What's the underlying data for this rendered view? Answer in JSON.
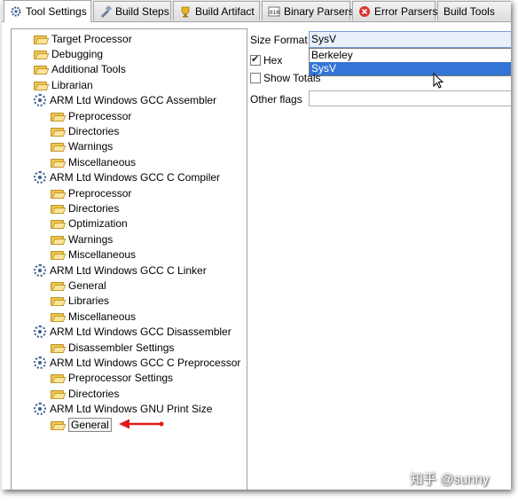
{
  "tabs": [
    {
      "label": "Tool Settings",
      "icon": "tool-settings-icon",
      "active": true
    },
    {
      "label": "Build Steps",
      "icon": "build-steps-icon"
    },
    {
      "label": "Build Artifact",
      "icon": "build-artifact-icon"
    },
    {
      "label": "Binary Parsers",
      "icon": "binary-parsers-icon"
    },
    {
      "label": "Error Parsers",
      "icon": "error-parsers-icon"
    },
    {
      "label": "Build Tools",
      "icon": ""
    }
  ],
  "tree": [
    {
      "label": "Target Processor",
      "level": 0,
      "icon": "folder-icon"
    },
    {
      "label": "Debugging",
      "level": 0,
      "icon": "folder-icon"
    },
    {
      "label": "Additional Tools",
      "level": 0,
      "icon": "folder-icon"
    },
    {
      "label": "Librarian",
      "level": 0,
      "icon": "folder-icon"
    },
    {
      "label": "ARM Ltd Windows GCC Assembler",
      "level": 0,
      "icon": "gear-icon"
    },
    {
      "label": "Preprocessor",
      "level": 1,
      "icon": "folder-icon"
    },
    {
      "label": "Directories",
      "level": 1,
      "icon": "folder-icon"
    },
    {
      "label": "Warnings",
      "level": 1,
      "icon": "folder-icon"
    },
    {
      "label": "Miscellaneous",
      "level": 1,
      "icon": "folder-icon"
    },
    {
      "label": "ARM Ltd Windows GCC C Compiler",
      "level": 0,
      "icon": "gear-icon"
    },
    {
      "label": "Preprocessor",
      "level": 1,
      "icon": "folder-icon"
    },
    {
      "label": "Directories",
      "level": 1,
      "icon": "folder-icon"
    },
    {
      "label": "Optimization",
      "level": 1,
      "icon": "folder-icon"
    },
    {
      "label": "Warnings",
      "level": 1,
      "icon": "folder-icon"
    },
    {
      "label": "Miscellaneous",
      "level": 1,
      "icon": "folder-icon"
    },
    {
      "label": "ARM Ltd Windows GCC C Linker",
      "level": 0,
      "icon": "gear-icon"
    },
    {
      "label": "General",
      "level": 1,
      "icon": "folder-icon"
    },
    {
      "label": "Libraries",
      "level": 1,
      "icon": "folder-icon"
    },
    {
      "label": "Miscellaneous",
      "level": 1,
      "icon": "folder-icon"
    },
    {
      "label": "ARM Ltd Windows GCC Disassembler",
      "level": 0,
      "icon": "gear-icon"
    },
    {
      "label": "Disassembler Settings",
      "level": 1,
      "icon": "folder-icon"
    },
    {
      "label": "ARM Ltd Windows GCC C Preprocessor",
      "level": 0,
      "icon": "gear-icon"
    },
    {
      "label": "Preprocessor Settings",
      "level": 1,
      "icon": "folder-icon"
    },
    {
      "label": "Directories",
      "level": 1,
      "icon": "folder-icon"
    },
    {
      "label": "ARM Ltd Windows GNU Print Size",
      "level": 0,
      "icon": "gear-icon"
    },
    {
      "label": "General",
      "level": 1,
      "icon": "folder-icon",
      "selected": true
    }
  ],
  "settings": {
    "size_format_label": "Size Format",
    "size_format_value": "SysV",
    "dropdown_options": [
      {
        "label": "Berkeley",
        "highlighted": false
      },
      {
        "label": "SysV",
        "highlighted": true
      }
    ],
    "hex_label": "Hex",
    "hex_checked": true,
    "show_totals_label": "Show Totals",
    "show_totals_checked": false,
    "other_flags_label": "Other flags",
    "other_flags_value": ""
  },
  "colors": {
    "annotation_arrow": "#e11a1a",
    "selection_highlight": "#3375d6"
  },
  "watermark": "知乎 @sunny"
}
